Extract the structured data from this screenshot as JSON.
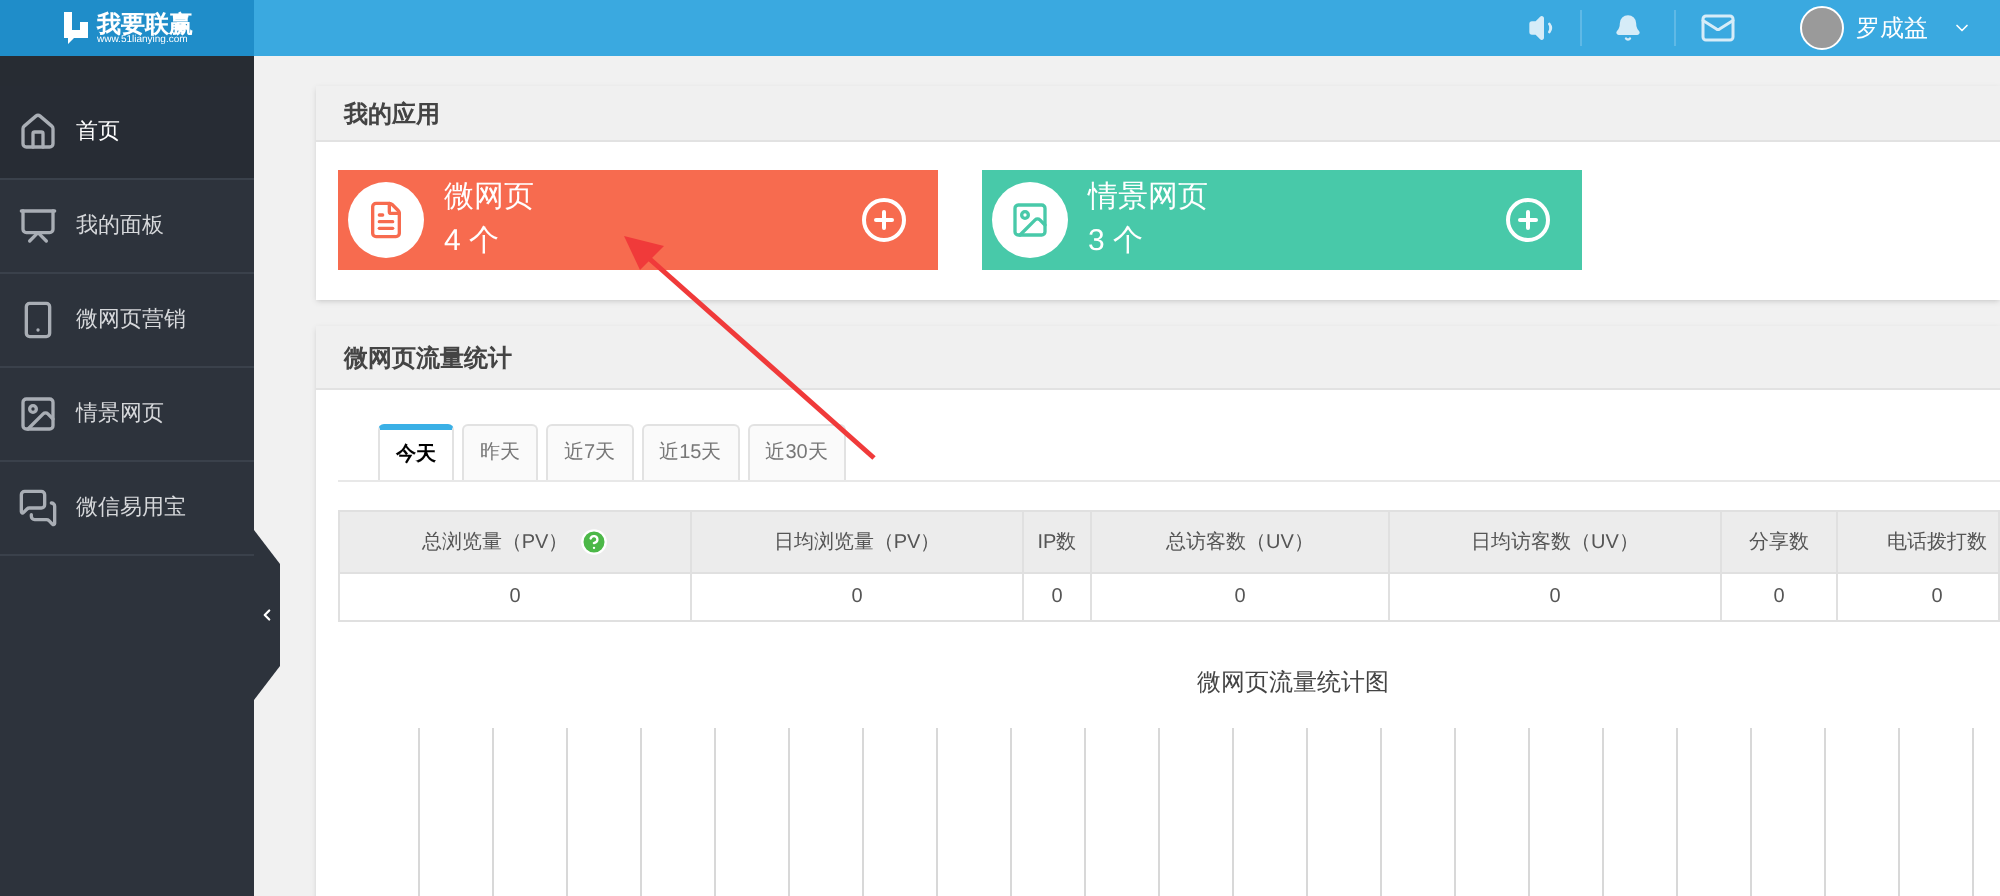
{
  "header": {
    "logo_text": "我要联赢",
    "logo_url": "www.51lianying.com",
    "user_name": "罗成益"
  },
  "sidebar": {
    "items": [
      {
        "label": "首页",
        "kind": "home",
        "selected": true
      },
      {
        "label": "我的面板",
        "kind": "panel",
        "selected": false
      },
      {
        "label": "微网页营销",
        "kind": "phone",
        "selected": false
      },
      {
        "label": "情景网页",
        "kind": "phone-image",
        "selected": false
      },
      {
        "label": "微信易用宝",
        "kind": "chat",
        "selected": false
      }
    ]
  },
  "apps": {
    "title": "我的应用",
    "tiles": [
      {
        "name": "微网页",
        "count": "4 个",
        "kind": "document",
        "color": "#f76b4f"
      },
      {
        "name": "情景网页",
        "count": "3 个",
        "kind": "image",
        "color": "#48c9a9"
      }
    ]
  },
  "traffic": {
    "title": "微网页流量统计",
    "tabs": [
      {
        "label": "今天",
        "selected": true
      },
      {
        "label": "昨天",
        "selected": false
      },
      {
        "label": "近7天",
        "selected": false
      },
      {
        "label": "近15天",
        "selected": false
      },
      {
        "label": "近30天",
        "selected": false
      }
    ],
    "table": {
      "columns": [
        {
          "label": "总浏览量（PV）",
          "help": true
        },
        {
          "label": "日均浏览量（PV）"
        },
        {
          "label": "IP数"
        },
        {
          "label": "总访客数（UV）"
        },
        {
          "label": "日均访客数（UV）"
        },
        {
          "label": "分享数"
        },
        {
          "label": "电话拨打数"
        }
      ],
      "rows": [
        [
          "0",
          "0",
          "0",
          "0",
          "0",
          "0",
          "0"
        ]
      ]
    },
    "chart_title": "微网页流量统计图"
  }
}
